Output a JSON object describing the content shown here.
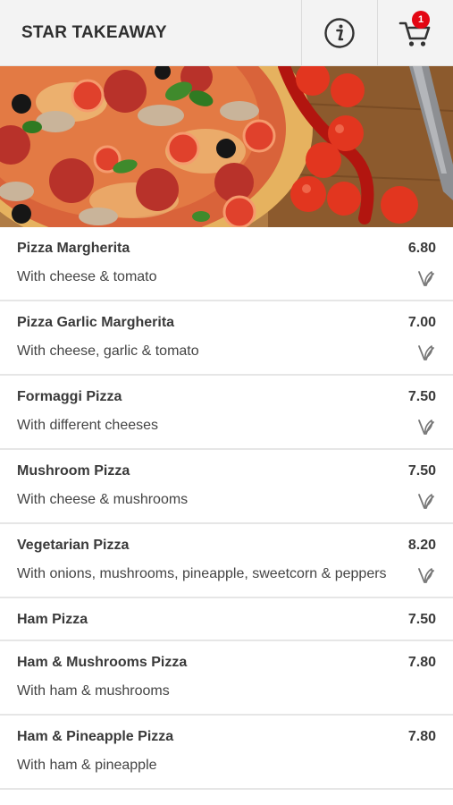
{
  "header": {
    "title": "STAR TAKEAWAY",
    "info_icon": "info-icon",
    "cart_icon": "cart-icon",
    "cart_count": "1"
  },
  "colors": {
    "header_bg": "#f3f3f3",
    "badge": "#e30613",
    "text": "#3a3a3a",
    "divider": "#e6e6e6"
  },
  "menu": [
    {
      "name": "Pizza Margherita",
      "price": "6.80",
      "desc": "With cheese & tomato",
      "vegetarian": true
    },
    {
      "name": "Pizza Garlic Margherita",
      "price": "7.00",
      "desc": "With cheese, garlic & tomato",
      "vegetarian": true
    },
    {
      "name": "Formaggi Pizza",
      "price": "7.50",
      "desc": "With different cheeses",
      "vegetarian": true
    },
    {
      "name": "Mushroom Pizza",
      "price": "7.50",
      "desc": "With cheese & mushrooms",
      "vegetarian": true
    },
    {
      "name": "Vegetarian Pizza",
      "price": "8.20",
      "desc": "With onions, mushrooms, pineapple, sweetcorn & peppers",
      "vegetarian": true
    },
    {
      "name": "Ham Pizza",
      "price": "7.50",
      "desc": "",
      "vegetarian": false
    },
    {
      "name": "Ham & Mushrooms Pizza",
      "price": "7.80",
      "desc": "With ham & mushrooms",
      "vegetarian": false
    },
    {
      "name": "Ham & Pineapple Pizza",
      "price": "7.80",
      "desc": "With ham & pineapple",
      "vegetarian": false
    }
  ]
}
